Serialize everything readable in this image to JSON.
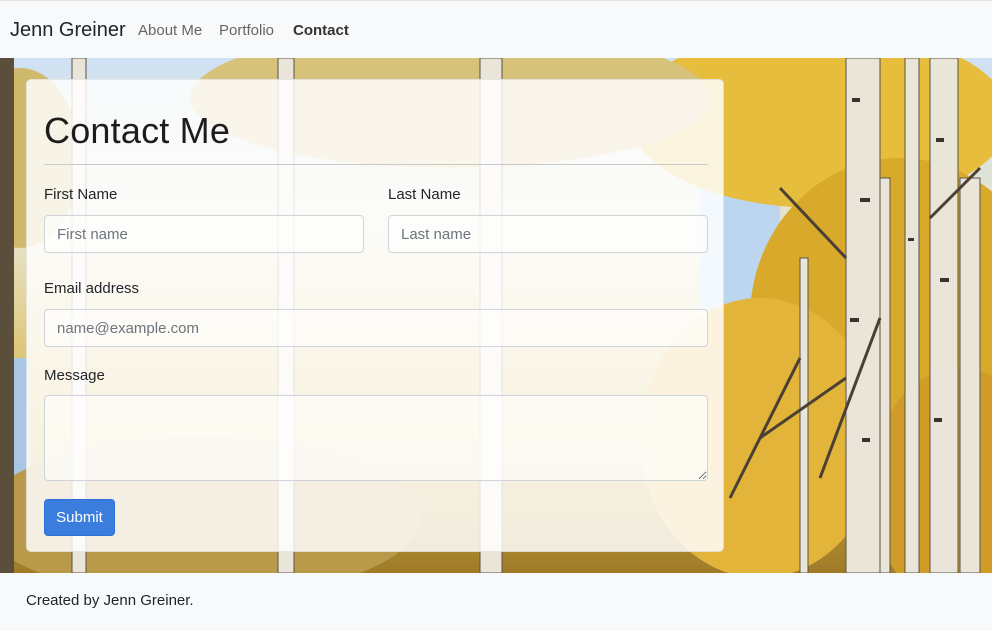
{
  "navbar": {
    "brand": "Jenn Greiner",
    "links": [
      {
        "label": "About Me"
      },
      {
        "label": "Portfolio"
      },
      {
        "label": "Contact",
        "active": true
      }
    ]
  },
  "form": {
    "title": "Contact Me",
    "first_name": {
      "label": "First Name",
      "placeholder": "First name"
    },
    "last_name": {
      "label": "Last Name",
      "placeholder": "Last name"
    },
    "email": {
      "label": "Email address",
      "placeholder": "name@example.com"
    },
    "message": {
      "label": "Message",
      "placeholder": ""
    },
    "submit_label": "Submit"
  },
  "footer": {
    "text": "Created by Jenn Greiner."
  },
  "colors": {
    "accent": "#3b7ddd",
    "navbar_bg": "#f8f9fa",
    "foliage": "#e1b53a"
  }
}
